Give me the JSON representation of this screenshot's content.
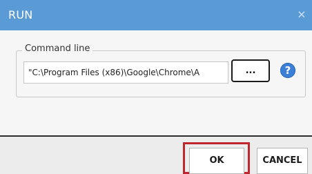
{
  "window": {
    "title": "RUN",
    "close_glyph": "×",
    "titlebar_color": "#5b9bd5"
  },
  "command_group": {
    "legend": "Command line",
    "command_value": "\"C:\\Program Files (x86)\\Google\\Chrome\\A",
    "browse_label": "...",
    "help_glyph": "?",
    "help_icon_color": "#3b80d6"
  },
  "footer": {
    "ok_label": "OK",
    "cancel_label": "CANCEL",
    "ok_highlight_color": "#c0262e"
  }
}
